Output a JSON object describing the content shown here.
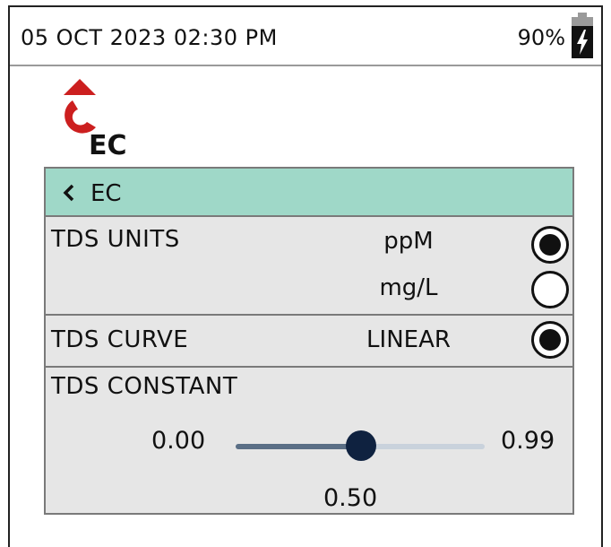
{
  "status_bar": {
    "datetime": "05 OCT 2023 02:30 PM",
    "battery_percent": "90%"
  },
  "logo": {
    "text": "EC",
    "accent_color": "#cc1f1f"
  },
  "panel": {
    "back_label": "EC",
    "header_color": "#9fd8c8",
    "tds_units": {
      "label": "TDS UNITS",
      "options": [
        {
          "label": "ppM",
          "selected": true
        },
        {
          "label": "mg/L",
          "selected": false
        }
      ]
    },
    "tds_curve": {
      "label": "TDS CURVE",
      "value": "LINEAR",
      "selected": true
    },
    "tds_constant": {
      "label": "TDS CONSTANT",
      "min": "0.00",
      "max": "0.99",
      "value": "0.50",
      "fraction": 0.505
    }
  }
}
